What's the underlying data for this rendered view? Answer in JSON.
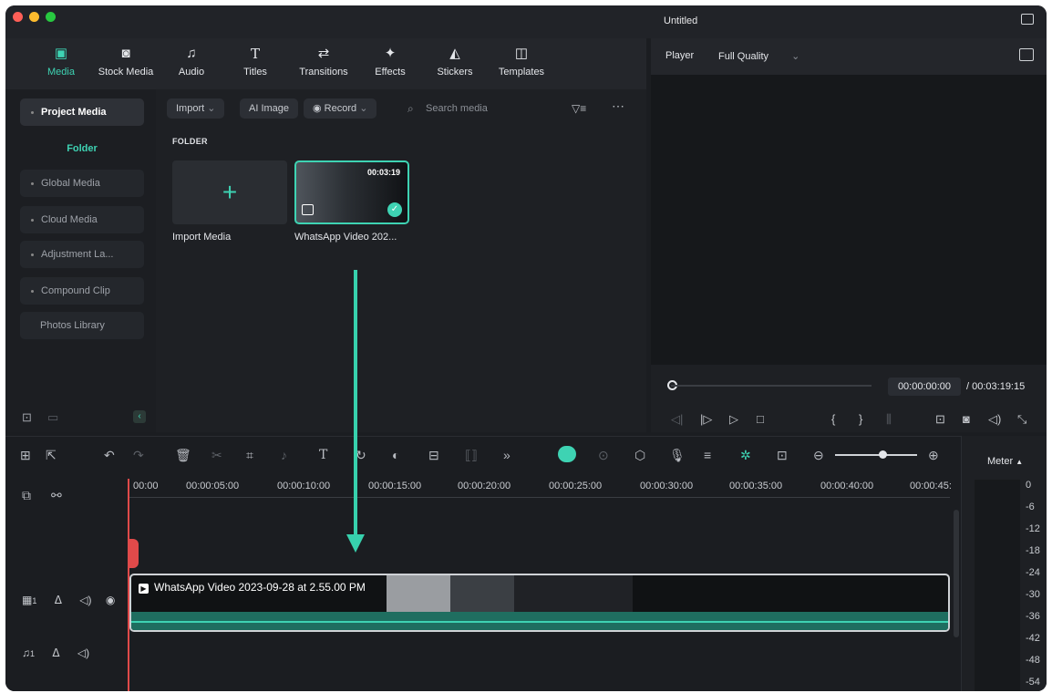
{
  "window": {
    "title": "Untitled"
  },
  "colors": {
    "accent": "#3ed3b3",
    "playhead": "#e04a4a",
    "background": "#1b1d21"
  },
  "toolbar": {
    "tabs": [
      {
        "label": "Media",
        "icon": "media-icon",
        "active": true
      },
      {
        "label": "Stock Media",
        "icon": "stock-media-icon"
      },
      {
        "label": "Audio",
        "icon": "audio-icon"
      },
      {
        "label": "Titles",
        "icon": "titles-icon"
      },
      {
        "label": "Transitions",
        "icon": "transitions-icon"
      },
      {
        "label": "Effects",
        "icon": "effects-icon"
      },
      {
        "label": "Stickers",
        "icon": "stickers-icon"
      },
      {
        "label": "Templates",
        "icon": "templates-icon"
      }
    ]
  },
  "sidebar": {
    "items": [
      {
        "label": "Project Media"
      },
      {
        "label": "Folder"
      },
      {
        "label": "Global Media"
      },
      {
        "label": "Cloud Media"
      },
      {
        "label": "Adjustment La..."
      },
      {
        "label": "Compound Clip"
      },
      {
        "label": "Photos Library"
      }
    ]
  },
  "media": {
    "import_label": "Import",
    "ai_image_label": "AI Image",
    "record_label": "Record",
    "search_placeholder": "Search media",
    "folder_heading": "FOLDER",
    "import_tile_caption": "Import Media",
    "clip_caption": "WhatsApp Video 202...",
    "clip_duration": "00:03:19"
  },
  "player": {
    "label": "Player",
    "quality": "Full Quality",
    "current_time": "00:00:00:00",
    "total_time": "/ 00:03:19:15",
    "progress": 0
  },
  "timeline": {
    "ruler": [
      "00:00",
      "00:00:05:00",
      "00:00:10:00",
      "00:00:15:00",
      "00:00:20:00",
      "00:00:25:00",
      "00:00:30:00",
      "00:00:35:00",
      "00:00:40:00",
      "00:00:45:"
    ],
    "video_track_label": "1",
    "audio_track_label": "1",
    "clip_title": "WhatsApp Video 2023-09-28 at 2.55.00 PM"
  },
  "meter": {
    "title": "Meter",
    "levels": [
      "0",
      "-6",
      "-12",
      "-18",
      "-24",
      "-30",
      "-36",
      "-42",
      "-48",
      "-54"
    ]
  }
}
